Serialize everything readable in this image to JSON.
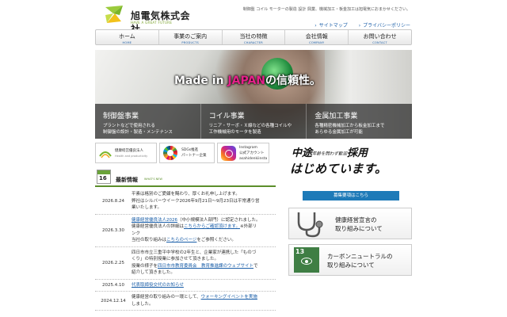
{
  "header": {
    "company_name": "旭電気株式会社",
    "tagline": "HAVE A GREAT FUTURE",
    "description": "制御盤 コイル モーターの製造 設計 興業、機械加工・板金加工は旭電気におまかせください。",
    "links": [
      "サイトマップ",
      "プライバシーポリシー"
    ]
  },
  "nav": [
    {
      "jp": "ホーム",
      "en": "HOME"
    },
    {
      "jp": "事業のご案内",
      "en": "PRODUCTS"
    },
    {
      "jp": "当社の特徴",
      "en": "CHARACTER"
    },
    {
      "jp": "会社情報",
      "en": "COMPANY"
    },
    {
      "jp": "お問い合わせ",
      "en": "CONTACT"
    }
  ],
  "hero": {
    "title_pre": "Made in ",
    "title_accent": "JAPAN",
    "title_post": "の信頼性。",
    "cards": [
      {
        "title": "制御盤事業",
        "desc1": "プラントなどで使用される",
        "desc2": "制御盤の設計・製造・メンテナンス"
      },
      {
        "title": "コイル事業",
        "desc1": "リニア・サーボ・Ｘ線などの各種コイルや",
        "desc2": "工作機械用のモータを製造"
      },
      {
        "title": "金属加工事業",
        "desc1": "各種精密機械加工から板金加工まで",
        "desc2": "あらゆる金属加工が可能"
      }
    ]
  },
  "banners": {
    "health": {
      "line1": "健康経営優良法人",
      "line2": "Health and productivity"
    },
    "sdgs": {
      "line1": "SDGs推進",
      "line2": "パートナー企業"
    },
    "instagram": {
      "line1": "Instagram",
      "line2": "公式アカウント",
      "line3": "asahidenkiinsta"
    }
  },
  "news": {
    "title": "最新情報",
    "title_en": "WHAT'S NEW",
    "calendar_number": "16",
    "items": [
      {
        "date": "2026.8.24",
        "l1": "平素は格別のご愛顧を賜わり、厚くお礼申し上げます。",
        "l2": "弊社はシルバーウイーク2026年9月21日〜9月23日は平常通り営",
        "l3": "業いたします。"
      },
      {
        "date": "2026.3.30",
        "link1": "健康経営優良法人2026",
        "t1": "（中小規模法人部門）に認定されました。",
        "l2": "健康経営優良法人の詳細は",
        "link2": "こちらからご確認頂けます。",
        "t2": "※外部リ",
        "l3": "ンク",
        "l4": "当社の取り組みは",
        "link3": "こちらのページ",
        "t3": "をご参照ください。"
      },
      {
        "date": "2026.2.25",
        "l1": "四日市市立三重平中学校の2年生と、企業家が連携した「ものづ",
        "l2": "くり」の特別授業に参加させて頂きました。",
        "l3": "授業の様子を",
        "link1": "四日市市教育委員会　教育推進課のウェブサイト",
        "t1": "で",
        "l4": "紹介して頂きました。"
      },
      {
        "date": "2025.4.10",
        "link1": "代表取締役交代のお知らせ"
      },
      {
        "date": "2024.12.14",
        "l1": "健康経営の取り組みの一環として、",
        "link1": "ウォーキングイベントを実施",
        "l2": "しました。"
      }
    ]
  },
  "recruit": {
    "line1_a": "中途",
    "line1_small": "年齢を問わず歓迎",
    "line1_b": "採用",
    "line2": "はじめています。",
    "button": "募集要項はこちら"
  },
  "side_banners": {
    "health": {
      "l1": "健康経営宣言の",
      "l2": "取り組みについて"
    },
    "carbon": {
      "l1": "カーボンニュートラルの",
      "l2": "取り組みについて",
      "sdg_number": "13"
    }
  },
  "colors": {
    "accent_pink": "#e5208a",
    "link_blue": "#1a5ea8",
    "brand_green": "#5b8e2a",
    "button_blue": "#1e7ab8"
  }
}
